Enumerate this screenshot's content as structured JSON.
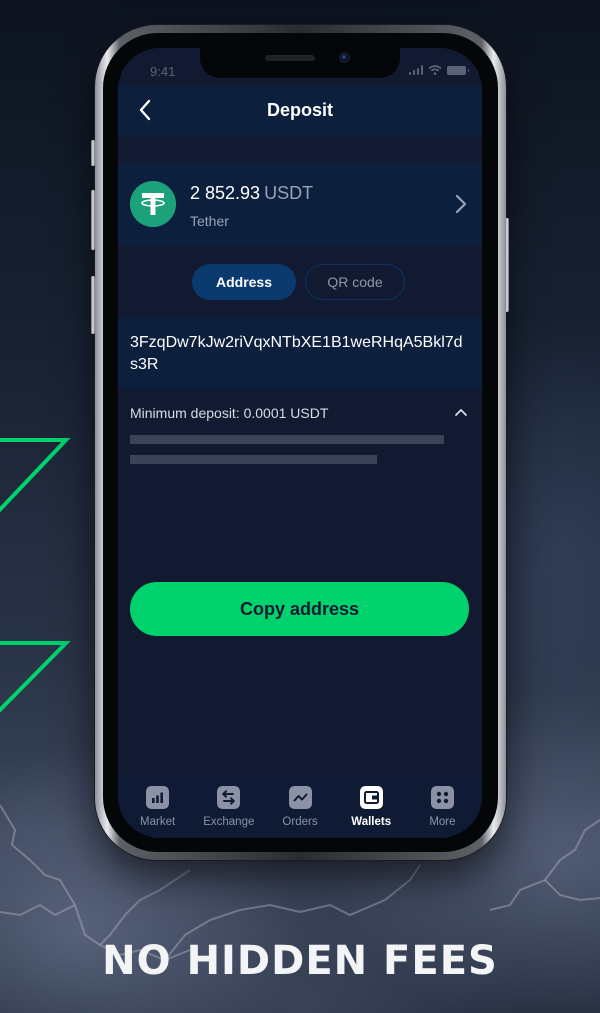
{
  "status_bar": {
    "time": "9:41"
  },
  "header": {
    "title": "Deposit",
    "back_icon": "chevron-left-icon"
  },
  "coin": {
    "amount": "2 852.93",
    "unit": "USDT",
    "name": "Tether",
    "logo_icon": "tether-logo-icon",
    "logo_color": "#1ba27a"
  },
  "toggle": {
    "options": [
      {
        "label": "Address",
        "active": true
      },
      {
        "label": "QR code",
        "active": false
      }
    ]
  },
  "address": {
    "value": "3FzqDw7kJw2riVqxNTbXE1B1weRHqA5Bkl7ds3R"
  },
  "min_deposit": {
    "label": "Minimum deposit: 0.0001 USDT",
    "expanded": true
  },
  "copy_button": {
    "label": "Copy address",
    "color": "#00d26e"
  },
  "tab_bar": {
    "tabs": [
      {
        "label": "Market",
        "icon": "bar-chart-icon",
        "active": false
      },
      {
        "label": "Exchange",
        "icon": "swap-arrows-icon",
        "active": false
      },
      {
        "label": "Orders",
        "icon": "line-chart-icon",
        "active": false
      },
      {
        "label": "Wallets",
        "icon": "wallet-icon",
        "active": true
      },
      {
        "label": "More",
        "icon": "grid-dots-icon",
        "active": false
      }
    ]
  },
  "promo": {
    "headline": "NO HIDDEN FEES",
    "accent_color": "#00d26e"
  },
  "colors": {
    "screen_bg": "#111a30",
    "card_bg": "#0c1f3d",
    "active_pill": "#0b3a6e"
  }
}
